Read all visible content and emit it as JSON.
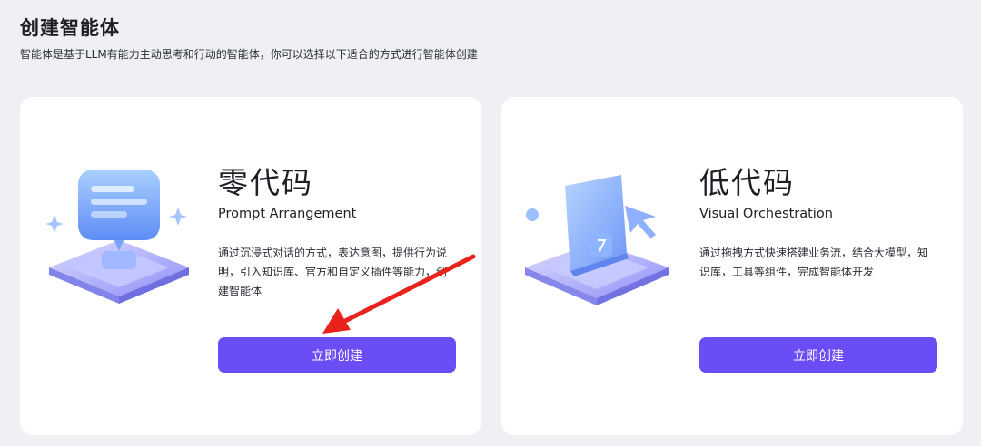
{
  "header": {
    "title": "创建智能体",
    "subtitle": "智能体是基于LLM有能力主动思考和行动的智能体，你可以选择以下适合的方式进行智能体创建"
  },
  "cards": [
    {
      "title": "零代码",
      "subtitle": "Prompt Arrangement",
      "description": "通过沉浸式对话的方式，表达意图，提供行为说明，引入知识库、官方和自定义插件等能力，创建智能体",
      "button_label": "立即创建",
      "icon": "chat-bubble-illustration"
    },
    {
      "title": "低代码",
      "subtitle": "Visual Orchestration",
      "description": "通过拖拽方式快速搭建业务流，结合大模型，知识库，工具等组件，完成智能体开发",
      "button_label": "立即创建",
      "icon": "cursor-window-illustration"
    }
  ],
  "colors": {
    "accent": "#6a4df5",
    "annotation_arrow": "#e8231c",
    "background": "#eef0f4"
  }
}
